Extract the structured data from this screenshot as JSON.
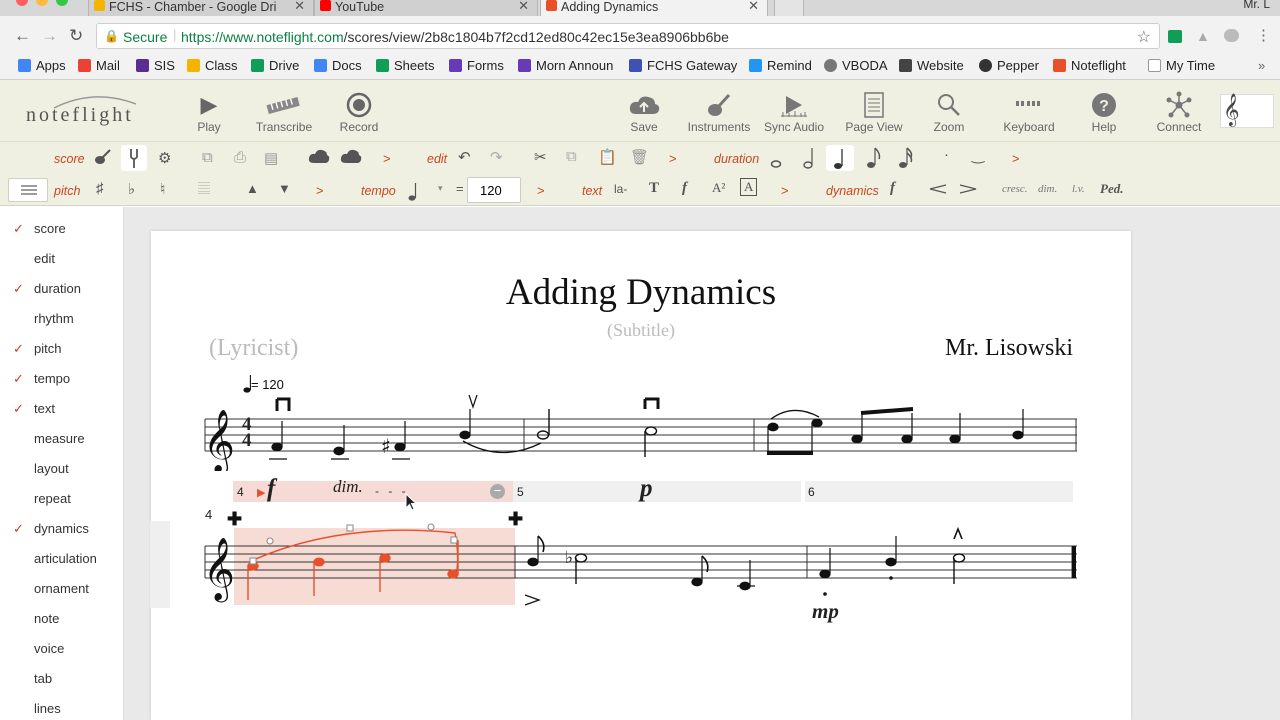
{
  "browser": {
    "tabs": [
      {
        "title": "FCHS - Chamber - Google Dri",
        "color": "#f4b400"
      },
      {
        "title": "YouTube",
        "color": "#ff0000"
      },
      {
        "title": "Adding Dynamics",
        "color": "#e8502a"
      }
    ],
    "profile": "Mr. L",
    "secure_label": "Secure",
    "url_host": "https://www.noteflight.com",
    "url_path": "/scores/view/2b8c1804b7f2cd12ed80c42ec15e3ea8906bb6be"
  },
  "bookmarks": [
    {
      "label": "Apps",
      "color": "#4285f4"
    },
    {
      "label": "Mail",
      "color": "#ea4335"
    },
    {
      "label": "SIS",
      "color": "#5c2d91"
    },
    {
      "label": "Class",
      "color": "#f4b400"
    },
    {
      "label": "Drive",
      "color": "#0f9d58"
    },
    {
      "label": "Docs",
      "color": "#4285f4"
    },
    {
      "label": "Sheets",
      "color": "#0f9d58"
    },
    {
      "label": "Forms",
      "color": "#673ab7"
    },
    {
      "label": "Morn Announ",
      "color": "#673ab7"
    },
    {
      "label": "FCHS Gateway",
      "color": "#3f51b5"
    },
    {
      "label": "Remind",
      "color": "#2196f3"
    },
    {
      "label": "VBODA",
      "color": "#777777"
    },
    {
      "label": "Website",
      "color": "#444444"
    },
    {
      "label": "Pepper",
      "color": "#333333"
    },
    {
      "label": "Noteflight",
      "color": "#e8502a"
    },
    {
      "label": "My Time",
      "color": "#999999"
    }
  ],
  "app": {
    "logo": "noteflight",
    "toolbar": [
      {
        "label": "Play",
        "icon": "play-icon"
      },
      {
        "label": "Transcribe",
        "icon": "piano-icon"
      },
      {
        "label": "Record",
        "icon": "record-icon"
      },
      {
        "label": "Save",
        "icon": "cloud-upload-icon"
      },
      {
        "label": "Instruments",
        "icon": "guitar-icon"
      },
      {
        "label": "Sync Audio",
        "icon": "sync-audio-icon"
      },
      {
        "label": "Page View",
        "icon": "page-icon"
      },
      {
        "label": "Zoom",
        "icon": "magnifier-icon"
      },
      {
        "label": "Keyboard",
        "icon": "keyboard-icon"
      },
      {
        "label": "Help",
        "icon": "help-icon"
      },
      {
        "label": "Connect",
        "icon": "connect-icon"
      }
    ],
    "palette_labels": {
      "score": "score",
      "edit": "edit",
      "duration": "duration",
      "pitch": "pitch",
      "tempo": "tempo",
      "text": "text",
      "dynamics": "dynamics"
    },
    "tempo_value": "120",
    "text_tools": [
      "la-",
      "T",
      "f",
      "A²",
      "A"
    ],
    "dynamics_tools": [
      "f",
      "cresc.",
      "dim.",
      "l.v.",
      "Ped."
    ]
  },
  "sidebar": [
    {
      "label": "score",
      "checked": true
    },
    {
      "label": "edit",
      "checked": false
    },
    {
      "label": "duration",
      "checked": true
    },
    {
      "label": "rhythm",
      "checked": false
    },
    {
      "label": "pitch",
      "checked": true
    },
    {
      "label": "tempo",
      "checked": true
    },
    {
      "label": "text",
      "checked": true
    },
    {
      "label": "measure",
      "checked": false
    },
    {
      "label": "layout",
      "checked": false
    },
    {
      "label": "repeat",
      "checked": false
    },
    {
      "label": "dynamics",
      "checked": true
    },
    {
      "label": "articulation",
      "checked": false
    },
    {
      "label": "ornament",
      "checked": false
    },
    {
      "label": "note",
      "checked": false
    },
    {
      "label": "voice",
      "checked": false
    },
    {
      "label": "tab",
      "checked": false
    },
    {
      "label": "lines",
      "checked": false
    }
  ],
  "score": {
    "title": "Adding Dynamics",
    "subtitle": "(Subtitle)",
    "lyricist": "(Lyricist)",
    "composer": "Mr. Lisowski",
    "tempo_mark": "= 120",
    "time_signature": [
      "4",
      "4"
    ],
    "measure_numbers": [
      "4",
      "5",
      "6"
    ],
    "second_system_number": "4",
    "dynamics": {
      "first": "f",
      "dim": "dim.",
      "piano": "p",
      "mezzo": "mp"
    }
  }
}
